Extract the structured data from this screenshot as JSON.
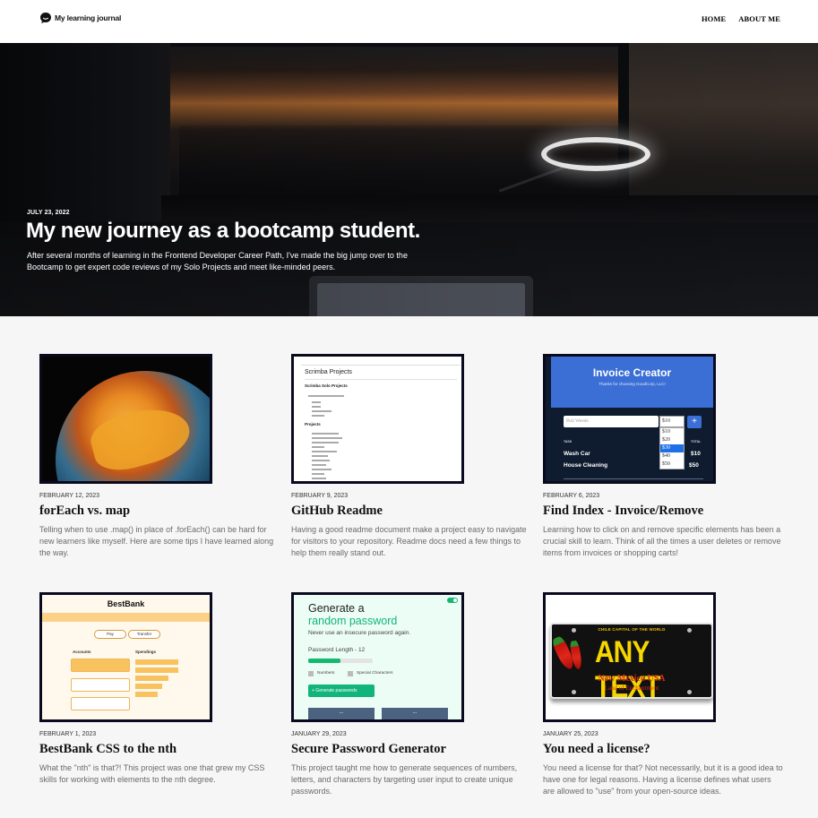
{
  "header": {
    "brand_name": "My learning journal",
    "brand_icon": "chat-bubble-icon",
    "nav": {
      "home": "HOME",
      "about": "ABOUT ME"
    }
  },
  "hero": {
    "date": "JULY 23, 2022",
    "title": "My new journey as a bootcamp student.",
    "description": "After several months of learning in the Frontend Developer Career Path, I've made the big jump over to the Bootcamp to get expert code reviews of my Solo Projects and meet like-minded peers."
  },
  "posts": [
    {
      "date": "FEBRUARY 12, 2023",
      "title": "forEach vs. map",
      "description": "Telling when to use .map() in place of .forEach() can be hard for new learners like myself. Here are some tips I have learned along the way."
    },
    {
      "date": "FEBRUARY 9, 2023",
      "title": "GitHub Readme",
      "description": "Having a good readme document make a project easy to navigate for visitors to your repository. Readme docs need a few things to help them really stand out."
    },
    {
      "date": "FEBRUARY 6, 2023",
      "title": "Find Index - Invoice/Remove",
      "description": "Learning how to click on and remove specific elements has been a crucial skill to learn. Think of all the times a user deletes or remove items from invoices or shopping carts!"
    },
    {
      "date": "FEBRUARY 1, 2023",
      "title": "BestBank CSS to the nth",
      "description": "What the \"nth\" is that?! This project was one that grew my CSS skills for working with elements to the nth degree."
    },
    {
      "date": "JANUARY 29, 2023",
      "title": "Secure Password Generator",
      "description": "This project taught me how to generate sequences of numbers, letters, and characters by targeting user input to create unique passwords."
    },
    {
      "date": "JANUARY 25, 2023",
      "title": "You need a license?",
      "description": "You need a license for that? Not necessarily, but it is a good idea to have one for legal reasons. Having a license defines what users are allowed to \"use\" from your open-source ideas."
    }
  ],
  "thumbs": {
    "readme": {
      "title": "Scrimba Projects",
      "section": "Scrimba Solo Projects",
      "section2": "Projects"
    },
    "invoice": {
      "title": "Invoice Creator",
      "subtitle": "Thanks for choosing GoodCorp, LLC!",
      "input_value": "Pull Weeds",
      "select_value": "$10",
      "options": [
        "$10",
        "$20",
        "$30",
        "$40",
        "$50"
      ],
      "selected_option": "$30",
      "task_header": "TASK",
      "total_header": "TOTAL",
      "rows": [
        {
          "task": "Wash Car",
          "amount": "$10"
        },
        {
          "task": "House Cleaning",
          "amount": "$50"
        }
      ]
    },
    "bank": {
      "logo": "BestBank",
      "pay": "Pay",
      "transfer": "Transfer",
      "accounts": "Accounts",
      "spendings": "Spendings"
    },
    "password": {
      "title_line1": "Generate a",
      "title_line2": "random password",
      "subtitle": "Never use an insecure password again.",
      "length_label": "Password Length - 12",
      "numbers_label": "Numbers",
      "special_label": "Special Characters",
      "button": "+ Generate passwords",
      "output1": "...",
      "output2": "...",
      "slider_fraction": 0.5
    },
    "plate": {
      "top_text": "CHILE CAPITAL OF THE WORLD",
      "main_text": "ANY TEXT",
      "state": "New Mexico USA",
      "motto": "Land of Enchantment"
    }
  },
  "colors": {
    "accent_green": "#11b47b",
    "invoice_blue": "#3b6fd6",
    "bank_gold": "#f8c35f",
    "thumb_border": "#0a0a1f"
  }
}
